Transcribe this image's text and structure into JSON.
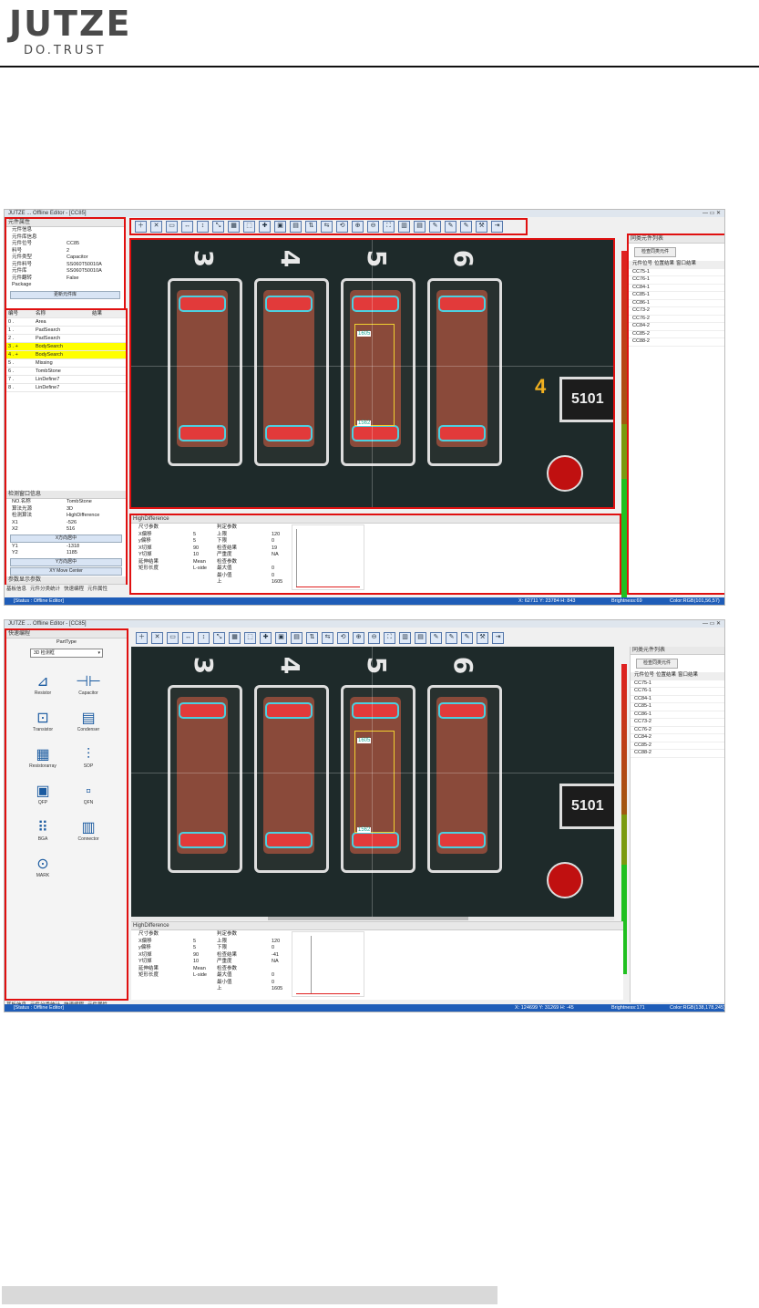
{
  "brand": {
    "name": "JUTZE",
    "tagline": "DO.TRUST"
  },
  "shot1": {
    "title": "JUTZE ... Offline Editor - [CC85]",
    "window_controls": "— ▭ ✕",
    "left_top": {
      "title": "元件属性",
      "section": "元件信息",
      "subsection": "元件库信息",
      "rows": [
        {
          "k": "元件位号",
          "v": "CC85"
        },
        {
          "k": "料号",
          "v": "2"
        },
        {
          "k": "元件类型",
          "v": "Capacitor"
        },
        {
          "k": "元件料号",
          "v": "SS060T50010A"
        },
        {
          "k": "元件库",
          "v": "SS060T50010A"
        },
        {
          "k": "元件翻转",
          "v": "False"
        },
        {
          "k": "Package",
          "v": ""
        }
      ],
      "button": "更新元件库"
    },
    "algo": {
      "headers": [
        "编号",
        "名称",
        "结果"
      ],
      "rows": [
        {
          "no": "0 .",
          "name": "Area",
          "hl": false
        },
        {
          "no": "1 .",
          "name": "PadSearch",
          "hl": false
        },
        {
          "no": "2 .",
          "name": "PadSearch",
          "hl": false
        },
        {
          "no": "3 . +",
          "name": "BodySearch",
          "hl": true
        },
        {
          "no": "4 . +",
          "name": "BodySearch",
          "hl": true
        },
        {
          "no": "5 .",
          "name": "Missing",
          "hl": false
        },
        {
          "no": "6 .",
          "name": "TombStone",
          "hl": false
        },
        {
          "no": "7 .",
          "name": "LinDefine7",
          "hl": false
        },
        {
          "no": "8 .",
          "name": "LinDefine7",
          "hl": false
        }
      ],
      "window_title": "检测窗口信息",
      "window_rows": [
        {
          "k": "NO.名称",
          "v": "TombStone"
        },
        {
          "k": "算法光源",
          "v": "3D"
        },
        {
          "k": "检测算法",
          "v": "HighDifference"
        },
        {
          "k": "X1",
          "v": "-526"
        },
        {
          "k": "X2",
          "v": "516"
        }
      ],
      "btn_x": "X方向居中",
      "window_rows2": [
        {
          "k": "Y1",
          "v": "-1318"
        },
        {
          "k": "Y2",
          "v": "1185"
        }
      ],
      "btn_y": "Y方向居中",
      "btn_xy": "XY Move Center",
      "footer": "参数显示参数"
    },
    "tabs": [
      "基板信息",
      "元件分类统计",
      "快速编程",
      "元件属性"
    ],
    "silk": [
      "3",
      "4",
      "5",
      "6"
    ],
    "box_labels": [
      "1605",
      "1562"
    ],
    "marker": "4",
    "chip_text": "5101",
    "bottom": {
      "title": "HighDifference",
      "col1_head": "尺寸参数",
      "col1": [
        {
          "k": "X偏移",
          "v": "5"
        },
        {
          "k": "y偏移",
          "v": "5"
        },
        {
          "k": "X切掉",
          "v": "90"
        },
        {
          "k": "Y切掉",
          "v": "10"
        },
        {
          "k": "延伸结果",
          "v": "Mean"
        },
        {
          "k": "矩形长度",
          "v": "L-side"
        }
      ],
      "col2_head": "判定参数",
      "col2": [
        {
          "k": "上限",
          "v": "120"
        },
        {
          "k": "下限",
          "v": "0"
        },
        {
          "k": "检查结果",
          "v": "19"
        },
        {
          "k": "严重度",
          "v": "NA"
        }
      ],
      "col2_head2": "检查参数",
      "col2b": [
        {
          "k": "最大值",
          "v": "0"
        },
        {
          "k": "最小值",
          "v": "0"
        },
        {
          "k": "上",
          "v": "1605"
        }
      ]
    },
    "right": {
      "title": "同类元件列表",
      "button": "检查同类元件",
      "headers": [
        "元件位号",
        "位置结果",
        "窗口结果"
      ],
      "items": [
        "CC75-1",
        "CC76-1",
        "CC84-1",
        "CC85-1",
        "CC86-1",
        "CC73-2",
        "CC76-2",
        "CC84-2",
        "CC85-2",
        "CC88-2"
      ]
    },
    "status": {
      "left": "[Status : Offline Editor]",
      "xy": "X: 62711 Y: 23784 H: 843",
      "brightness": "Brightness:69",
      "color": "Color:RGB(101,56,57)"
    }
  },
  "shot2": {
    "title": "JUTZE ... Offline Editor - [CC85]",
    "window_controls": "— ▭ ✕",
    "left": {
      "title": "快速编程",
      "header": "PartType",
      "select": "3D 检测框",
      "icons": [
        {
          "name": "Resistor",
          "glyph": "⊿"
        },
        {
          "name": "Capacitor",
          "glyph": "⊣⊢"
        },
        {
          "name": "Transistor",
          "glyph": "⊡"
        },
        {
          "name": "Condenser",
          "glyph": "▤"
        },
        {
          "name": "Resistorarray",
          "glyph": "▦"
        },
        {
          "name": "SOP",
          "glyph": "⫶"
        },
        {
          "name": "QFP",
          "glyph": "▣"
        },
        {
          "name": "QFN",
          "glyph": "▫"
        },
        {
          "name": "BGA",
          "glyph": "⠿"
        },
        {
          "name": "Connector",
          "glyph": "▥"
        },
        {
          "name": "MARK",
          "glyph": "⊙"
        }
      ]
    },
    "tabs": [
      "基板信息",
      "元件分类统计",
      "快速编程",
      "元件属性"
    ],
    "silk": [
      "3",
      "4",
      "5",
      "6"
    ],
    "box_labels": [
      "1605",
      "1562"
    ],
    "chip_text": "5101",
    "bottom": {
      "title": "HighDifference",
      "col1_head": "尺寸参数",
      "col1": [
        {
          "k": "X偏移",
          "v": "5"
        },
        {
          "k": "y偏移",
          "v": "5"
        },
        {
          "k": "X切掉",
          "v": "90"
        },
        {
          "k": "Y切掉",
          "v": "10"
        },
        {
          "k": "延伸结果",
          "v": "Mean"
        },
        {
          "k": "矩形长度",
          "v": "L-side"
        }
      ],
      "col2_head": "判定参数",
      "col2": [
        {
          "k": "上限",
          "v": "120"
        },
        {
          "k": "下限",
          "v": "0"
        },
        {
          "k": "检查结果",
          "v": "-41"
        },
        {
          "k": "严重度",
          "v": "NA"
        }
      ],
      "col2_head2": "检查参数",
      "col2b": [
        {
          "k": "最大值",
          "v": "0"
        },
        {
          "k": "最小值",
          "v": "0"
        },
        {
          "k": "上",
          "v": "1605"
        }
      ]
    },
    "right": {
      "title": "同类元件列表",
      "button": "检查同类元件",
      "headers": [
        "元件位号",
        "位置结果",
        "窗口结果"
      ],
      "items": [
        "CC75-1",
        "CC76-1",
        "CC84-1",
        "CC85-1",
        "CC86-1",
        "CC73-2",
        "CC76-2",
        "CC84-2",
        "CC85-2",
        "CC88-2"
      ]
    },
    "status": {
      "left": "[Status : Offline Editor]",
      "xy": "X: 124699 Y: 31269 H: -45",
      "brightness": "Brightness:171",
      "color": "Color:RGB(138,178,245)"
    }
  },
  "toolbar_icons": [
    "add",
    "delete",
    "copy",
    "h-align",
    "v-align",
    "move",
    "group",
    "select",
    "color",
    "image1",
    "image2",
    "flip",
    "mirror",
    "rotate",
    "zoom-in",
    "zoom-out",
    "fit",
    "layer1",
    "layer2",
    "pen1",
    "pen2",
    "pen3",
    "tool",
    "exit"
  ]
}
